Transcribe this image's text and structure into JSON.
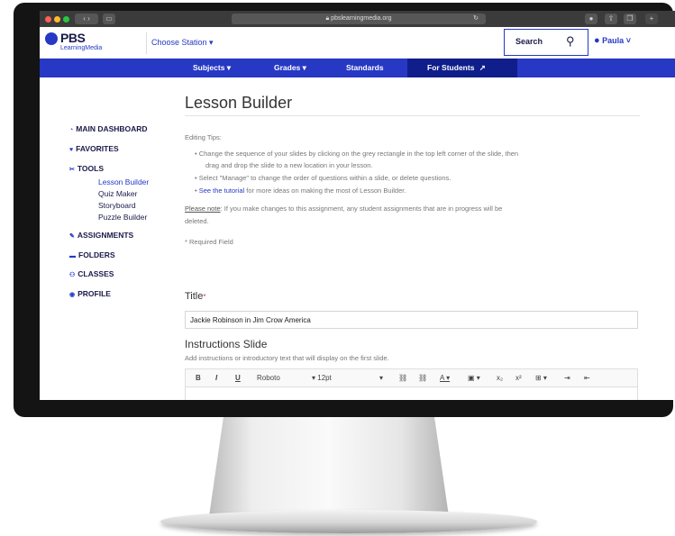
{
  "browser": {
    "url": "pbslearningmedia.org",
    "colors": {
      "chrome": "#3b3b3b",
      "close": "#ff5f57",
      "minimize": "#febc2e",
      "zoom": "#28c840"
    }
  },
  "header": {
    "logo_text": "PBS",
    "logo_sub": "LearningMedia",
    "station_label": "Choose Station ▾",
    "search_label": "Search",
    "user_label": "Paula"
  },
  "nav": {
    "items": [
      "Subjects ▾",
      "Grades ▾",
      "Standards",
      "For Students"
    ],
    "accent": "#2638c4"
  },
  "sidebar": {
    "items": [
      {
        "label": "MAIN DASHBOARD",
        "icon": "dashboard-icon"
      },
      {
        "label": "FAVORITES",
        "icon": "heart-icon"
      },
      {
        "label": "TOOLS",
        "icon": "tools-icon"
      },
      {
        "label": "ASSIGNMENTS",
        "icon": "assignments-icon"
      },
      {
        "label": "FOLDERS",
        "icon": "folder-icon"
      },
      {
        "label": "CLASSES",
        "icon": "classes-icon"
      },
      {
        "label": "PROFILE",
        "icon": "profile-icon"
      }
    ],
    "tools_sub": [
      "Lesson Builder",
      "Quiz Maker",
      "Storyboard",
      "Puzzle Builder"
    ]
  },
  "main": {
    "title": "Lesson Builder",
    "tips_heading": "Editing Tips:",
    "tips": [
      "Change the sequence of your slides by clicking on the grey rectangle in the top left corner of the slide, then",
      "drag and drop the slide to a new location in your lesson.",
      "Select \"Manage\" to change the order of questions within a slide, or delete questions.",
      "See the tutorial",
      "for more ideas on making the most of Lesson Builder."
    ],
    "note_link": "Please note",
    "note_text_1": ": If you make changes to this assignment, any student assignments that are in progress will be",
    "note_text_2": "deleted.",
    "required_note": "* Required Field",
    "title_label": "Title",
    "title_value": "Jackie Robinson in Jim Crow America",
    "instructions_label": "Instructions Slide",
    "instructions_sub": "Add instructions or introductory text that will display on the first slide.",
    "toolbar": {
      "bold": "B",
      "italic": "I",
      "underline": "U",
      "font": "Roboto",
      "size": "12pt"
    }
  }
}
